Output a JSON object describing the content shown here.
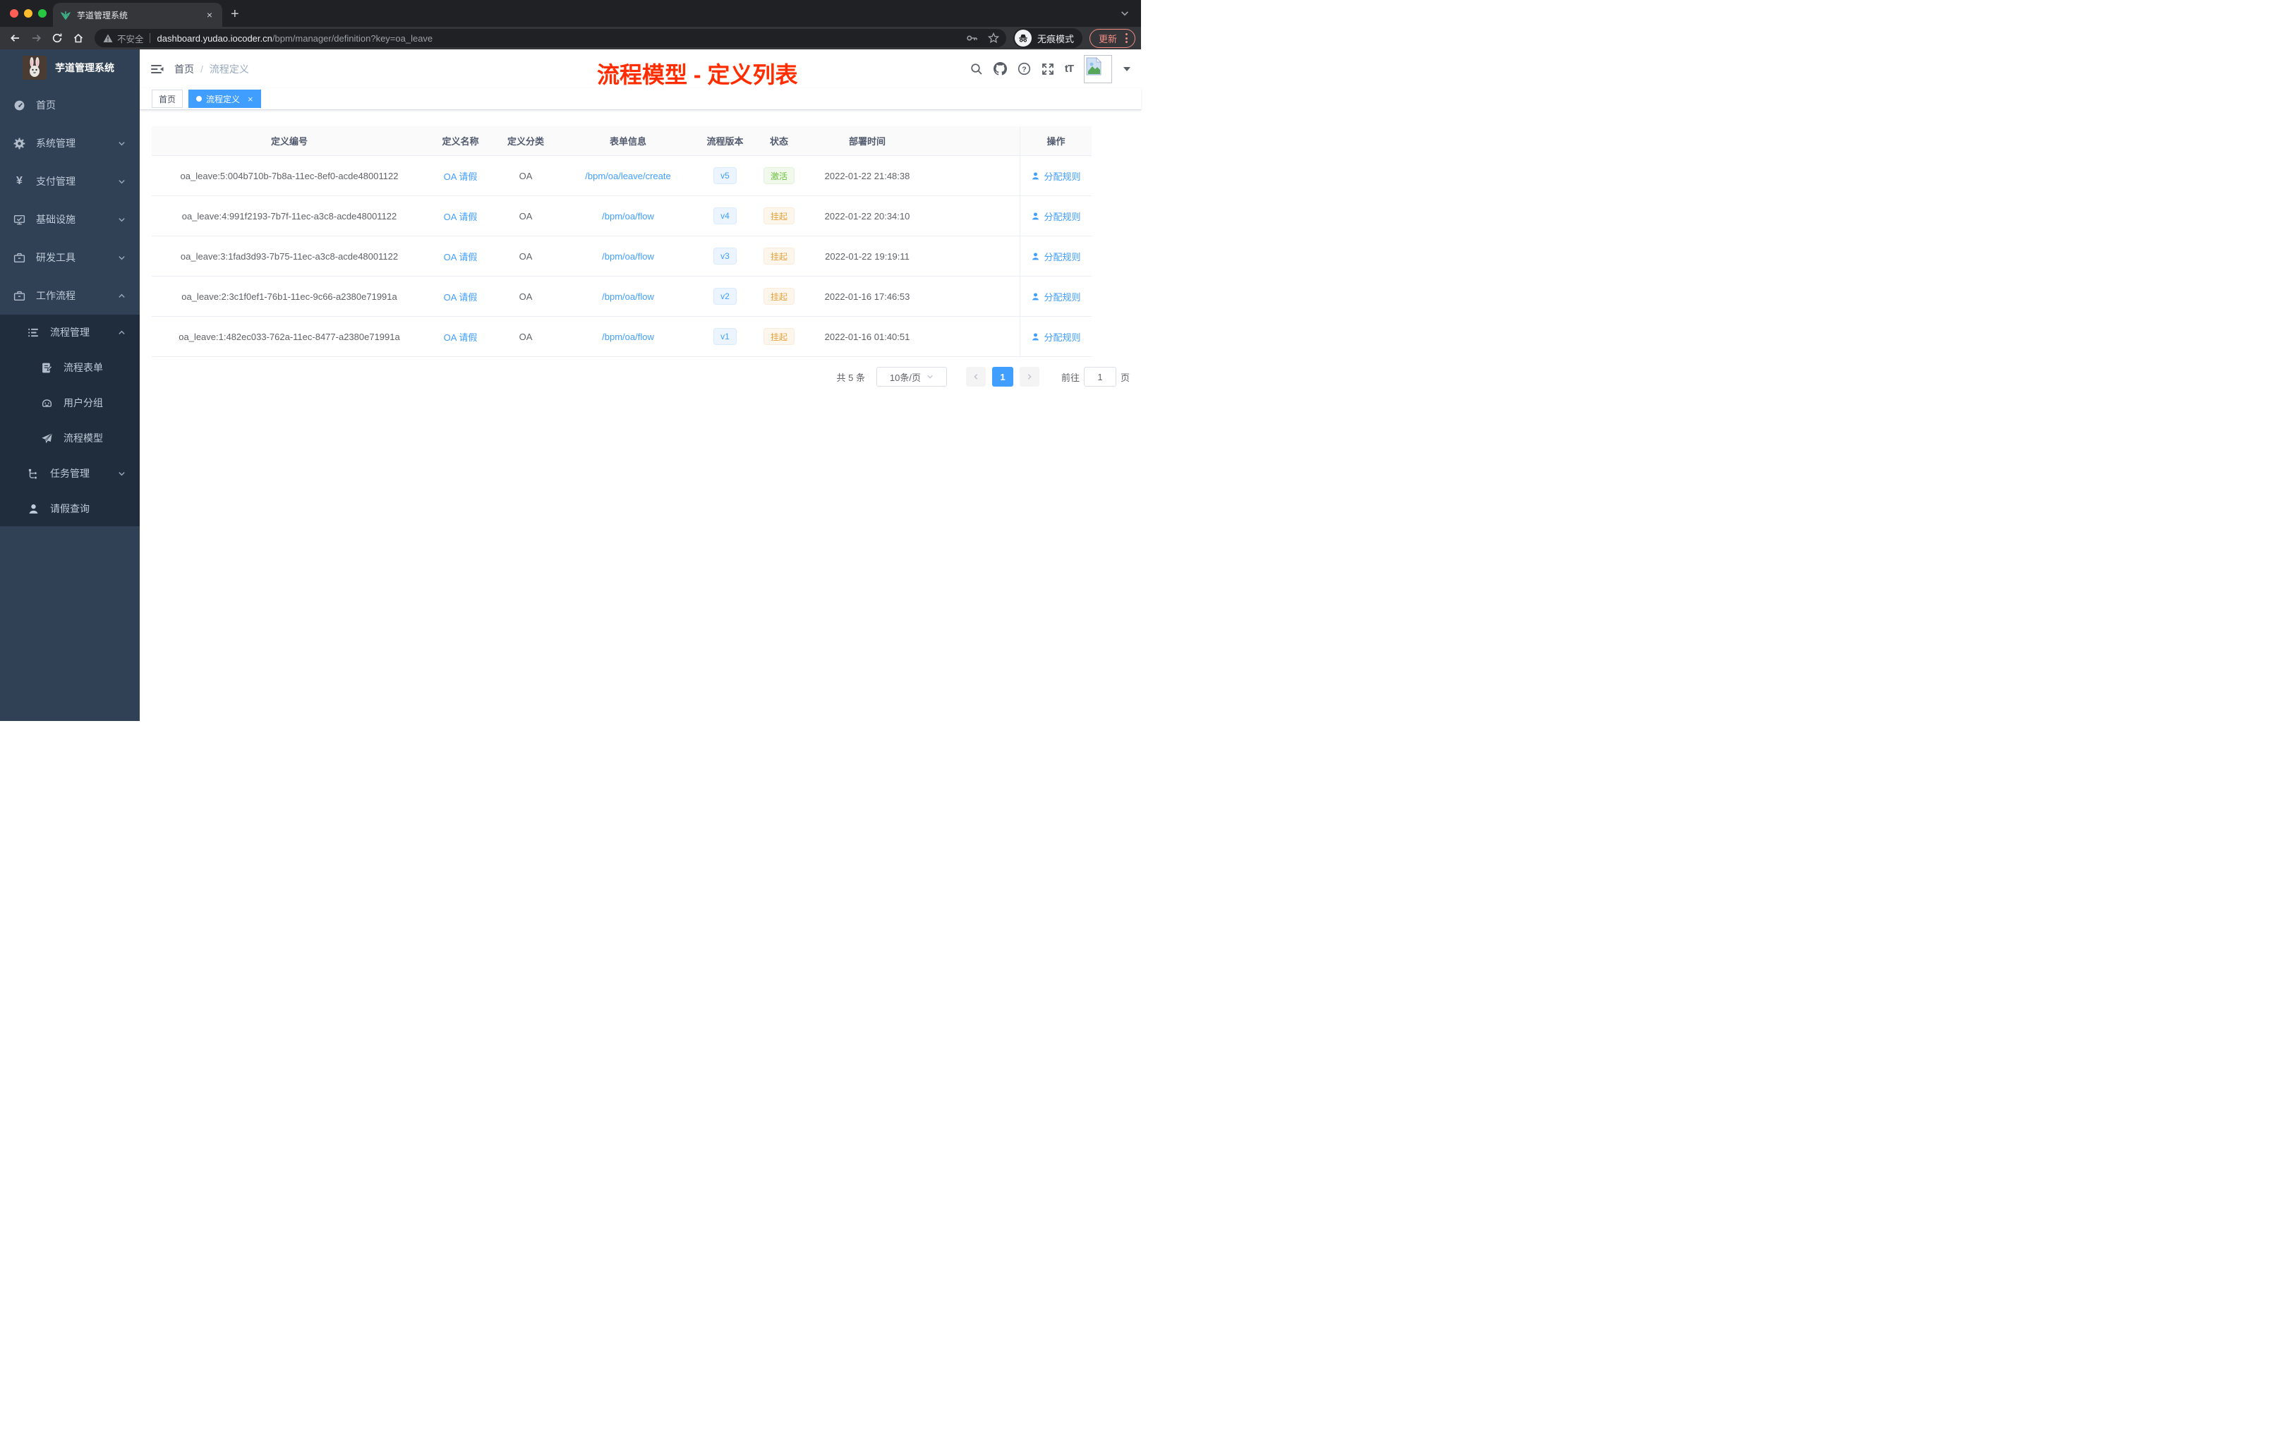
{
  "browser": {
    "tab_title": "芋道管理系统",
    "new_tab_label": "+",
    "close_tab_label": "×",
    "security_label": "不安全",
    "url_host": "dashboard.yudao.iocoder.cn",
    "url_path": "/bpm/manager/definition?key=oa_leave",
    "incognito_label": "无痕模式",
    "update_label": "更新",
    "toolbar_icons": [
      "back-icon",
      "forward-icon",
      "reload-icon",
      "home-icon",
      "key-icon",
      "star-icon",
      "incognito-icon",
      "kebab-menu-icon"
    ]
  },
  "sidebar": {
    "app_title": "芋道管理系统",
    "menu": [
      {
        "label": "首页",
        "icon": "dashboard-icon"
      },
      {
        "label": "系统管理",
        "icon": "gear-icon",
        "arrow": "down"
      },
      {
        "label": "支付管理",
        "icon": "yen-icon",
        "arrow": "down"
      },
      {
        "label": "基础设施",
        "icon": "monitor-icon",
        "arrow": "down"
      },
      {
        "label": "研发工具",
        "icon": "toolbox-icon",
        "arrow": "down"
      },
      {
        "label": "工作流程",
        "icon": "briefcase-icon",
        "arrow": "up"
      },
      {
        "label": "流程管理",
        "icon": "list-icon",
        "arrow": "up"
      },
      {
        "label": "流程表单",
        "icon": "form-icon"
      },
      {
        "label": "用户分组",
        "icon": "robot-icon"
      },
      {
        "label": "流程模型",
        "icon": "paper-plane-icon"
      },
      {
        "label": "任务管理",
        "icon": "flow-icon",
        "arrow": "down"
      },
      {
        "label": "请假查询",
        "icon": "user-icon"
      }
    ]
  },
  "header": {
    "breadcrumb": [
      "首页",
      "流程定义"
    ],
    "annotation": "流程模型 - 定义列表",
    "annotation_color": "#ff2d00",
    "icons": [
      "search-icon",
      "github-icon",
      "help-icon",
      "fullscreen-icon",
      "font-size-icon",
      "avatar",
      "caret-down-icon"
    ]
  },
  "tags": [
    {
      "label": "首页",
      "active": false
    },
    {
      "label": "流程定义",
      "active": true,
      "close_label": "×"
    }
  ],
  "table": {
    "columns": [
      "定义编号",
      "定义名称",
      "定义分类",
      "表单信息",
      "流程版本",
      "状态",
      "部署时间",
      "操作"
    ],
    "rows": [
      {
        "id": "oa_leave:5:004b710b-7b8a-11ec-8ef0-acde48001122",
        "name": "OA 请假",
        "category": "OA",
        "form": "/bpm/oa/leave/create",
        "version": "v5",
        "status": "激活",
        "status_type": "success",
        "deploy_time": "2022-01-22 21:48:38",
        "action": "分配规则"
      },
      {
        "id": "oa_leave:4:991f2193-7b7f-11ec-a3c8-acde48001122",
        "name": "OA 请假",
        "category": "OA",
        "form": "/bpm/oa/flow",
        "version": "v4",
        "status": "挂起",
        "status_type": "warning",
        "deploy_time": "2022-01-22 20:34:10",
        "action": "分配规则"
      },
      {
        "id": "oa_leave:3:1fad3d93-7b75-11ec-a3c8-acde48001122",
        "name": "OA 请假",
        "category": "OA",
        "form": "/bpm/oa/flow",
        "version": "v3",
        "status": "挂起",
        "status_type": "warning",
        "deploy_time": "2022-01-22 19:19:11",
        "action": "分配规则"
      },
      {
        "id": "oa_leave:2:3c1f0ef1-76b1-11ec-9c66-a2380e71991a",
        "name": "OA 请假",
        "category": "OA",
        "form": "/bpm/oa/flow",
        "version": "v2",
        "status": "挂起",
        "status_type": "warning",
        "deploy_time": "2022-01-16 17:46:53",
        "action": "分配规则"
      },
      {
        "id": "oa_leave:1:482ec033-762a-11ec-8477-a2380e71991a",
        "name": "OA 请假",
        "category": "OA",
        "form": "/bpm/oa/flow",
        "version": "v1",
        "status": "挂起",
        "status_type": "warning",
        "deploy_time": "2022-01-16 01:40:51",
        "action": "分配规则"
      }
    ]
  },
  "pagination": {
    "total_label": "共 5 条",
    "page_size_label": "10条/页",
    "current_page": "1",
    "goto_label": "前往",
    "goto_value": "1",
    "page_unit": "页"
  },
  "colors": {
    "accent_blue": "#409eff",
    "status_active_green": "#67c23a",
    "status_suspend_orange": "#e6a23c",
    "sidebar_bg": "#304156",
    "submenu_bg": "#1f2d3d",
    "chrome_dark": "#202124",
    "chrome_toolbar": "#35363a",
    "update_red": "#f28b82"
  }
}
